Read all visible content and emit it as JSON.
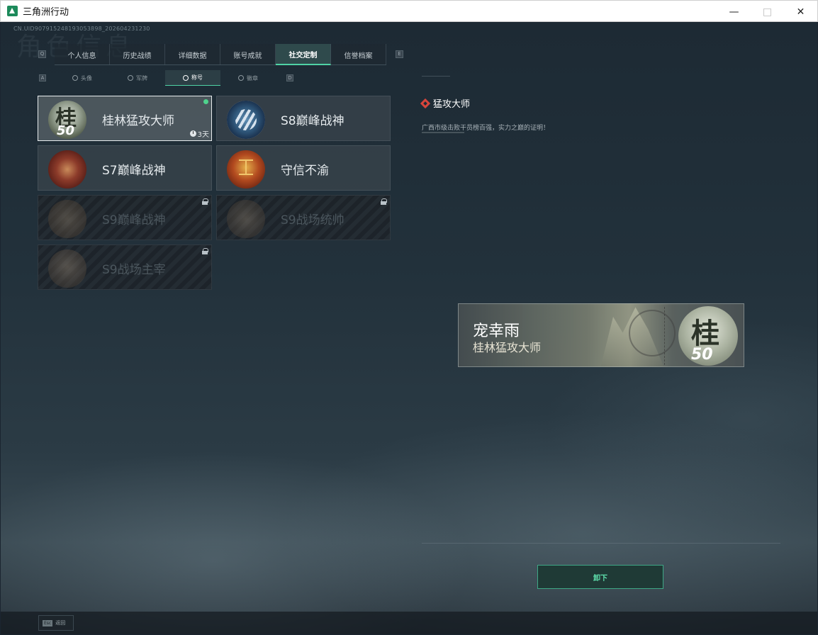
{
  "window": {
    "title": "三角洲行动",
    "controls": [
      "minimize",
      "maximize",
      "close"
    ]
  },
  "header": {
    "uid": "CN.UID907915248193053898_202604231230",
    "bg_title": "角色信息"
  },
  "main_tabs": [
    {
      "label": "个人信息"
    },
    {
      "label": "历史战绩"
    },
    {
      "label": "详细数据"
    },
    {
      "label": "账号成就"
    },
    {
      "label": "社交定制"
    },
    {
      "label": "信誉档案"
    }
  ],
  "main_tabs_active": "社交定制",
  "nav_keys": {
    "left": "Q",
    "right": "E",
    "sub_left": "A",
    "sub_right": "D"
  },
  "sub_tabs": [
    {
      "label": "头像"
    },
    {
      "label": "军牌"
    },
    {
      "label": "称号"
    },
    {
      "label": "徽章"
    }
  ],
  "sub_tabs_active": "称号",
  "titles": [
    {
      "label": "桂林猛攻大师",
      "badge": "gui-50",
      "badge_char": "桂",
      "badge_num": "50",
      "timer": "3天",
      "selected": true,
      "equipped": true,
      "locked": false
    },
    {
      "label": "S8巅峰战神",
      "badge": "s8",
      "selected": false,
      "locked": false
    },
    {
      "label": "S7巅峰战神",
      "badge": "s7",
      "selected": false,
      "locked": false
    },
    {
      "label": "守信不渝",
      "badge": "xin",
      "selected": false,
      "locked": false
    },
    {
      "label": "S9巅峰战神",
      "badge": "s9a",
      "selected": false,
      "locked": true
    },
    {
      "label": "S9战场统帅",
      "badge": "s9b",
      "selected": false,
      "locked": true
    },
    {
      "label": "S9战场主宰",
      "badge": "s9c",
      "selected": false,
      "locked": true
    }
  ],
  "detail": {
    "title": "猛攻大师",
    "description": "广西市级击败干员榜百强，实力之巅的证明！"
  },
  "nameplate": {
    "player_name": "宠幸雨",
    "title": "桂林猛攻大师",
    "badge_char": "桂",
    "badge_num": "50"
  },
  "actions": {
    "unequip": "卸下"
  },
  "footer": {
    "esc_key": "Esc",
    "back_label": "返回"
  },
  "colors": {
    "accent": "#4fd3a5",
    "equipped": "#4fd38d",
    "diamond": "#d8453c"
  }
}
